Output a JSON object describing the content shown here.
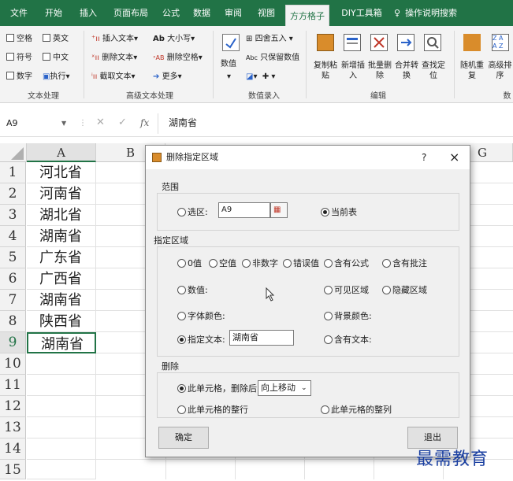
{
  "ribbon_tabs": [
    "文件",
    "开始",
    "插入",
    "页面布局",
    "公式",
    "数据",
    "审阅",
    "视图",
    "方方格子",
    "DIY工具箱",
    "操作说明搜索"
  ],
  "active_tab": "方方格子",
  "ribbon": {
    "text_group": {
      "items": [
        "空格",
        "英文",
        "符号",
        "中文",
        "数字",
        "执行"
      ],
      "label": "文本处理"
    },
    "adv_group": {
      "items": [
        "插入文本",
        "删除文本",
        "截取文本",
        "大小写",
        "删除空格",
        "更多"
      ],
      "label": "高级文本处理"
    },
    "num_group": {
      "items": [
        "数值",
        "四舍五入",
        "只保留数值"
      ],
      "label": "数值录入"
    },
    "edit_group": {
      "items": [
        "复制粘贴",
        "新增插入",
        "批量删除",
        "合并转换",
        "查找定位"
      ],
      "label": "编辑"
    },
    "more_group": {
      "items": [
        "随机重复",
        "高级排序"
      ],
      "label": "数"
    }
  },
  "formula_bar": {
    "cell_ref": "A9",
    "fx": "fx",
    "value": "湖南省"
  },
  "columns": [
    "A",
    "B",
    "G"
  ],
  "rows": [
    "1",
    "2",
    "3",
    "4",
    "5",
    "6",
    "7",
    "8",
    "9",
    "10",
    "11",
    "12",
    "13",
    "14",
    "15"
  ],
  "cells": [
    "河北省",
    "河南省",
    "湖北省",
    "湖南省",
    "广东省",
    "广西省",
    "湖南省",
    "陕西省",
    "湖南省"
  ],
  "dialog": {
    "title": "删除指定区域",
    "help": "?",
    "close": "×",
    "scope": {
      "legend": "范围",
      "selection_label": "选区:",
      "selection_value": "A9",
      "current_sheet_label": "当前表"
    },
    "region": {
      "legend": "指定区域",
      "zero": "0值",
      "blank": "空值",
      "non_number": "非数字",
      "error": "错误值",
      "has_formula": "含有公式",
      "has_comment": "含有批注",
      "number": "数值:",
      "visible": "可见区域",
      "hidden": "隐藏区域",
      "font_color": "字体颜色:",
      "bg_color": "背景颜色:",
      "specified_text": "指定文本:",
      "specified_text_value": "湖南省",
      "contains_text": "含有文本:"
    },
    "delete": {
      "legend": "删除",
      "this_cell": "此单元格，删除后",
      "shift_option": "向上移动",
      "whole_row": "此单元格的整行",
      "whole_col": "此单元格的整列"
    },
    "ok": "确定",
    "exit": "退出"
  },
  "watermark": "最需教育",
  "colors": {
    "excel_green": "#217346"
  }
}
